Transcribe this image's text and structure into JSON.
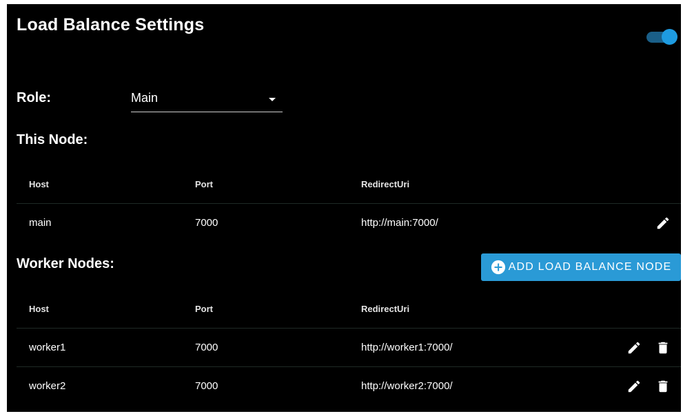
{
  "settings": {
    "title": "Load Balance Settings",
    "enabled": true
  },
  "role": {
    "label": "Role:",
    "selected": "Main"
  },
  "this_node": {
    "title": "This Node:",
    "columns": [
      "Host",
      "Port",
      "RedirectUri"
    ],
    "rows": [
      {
        "host": "main",
        "port": "7000",
        "redirect_uri": "http://main:7000/"
      }
    ]
  },
  "worker_nodes": {
    "title": "Worker Nodes:",
    "add_button_label": "ADD LOAD BALANCE NODE",
    "columns": [
      "Host",
      "Port",
      "RedirectUri"
    ],
    "rows": [
      {
        "host": "worker1",
        "port": "7000",
        "redirect_uri": "http://worker1:7000/"
      },
      {
        "host": "worker2",
        "port": "7000",
        "redirect_uri": "http://worker2:7000/"
      }
    ]
  },
  "icons": {
    "edit": "pencil-icon",
    "delete": "trash-icon",
    "add": "plus-circle-icon",
    "dropdown": "caret-down-icon"
  },
  "colors": {
    "background": "#000000",
    "accent": "#2a9ad6",
    "toggle_thumb": "#1e9be0",
    "toggle_track": "#1a5f88",
    "divider": "#1f2a26"
  }
}
